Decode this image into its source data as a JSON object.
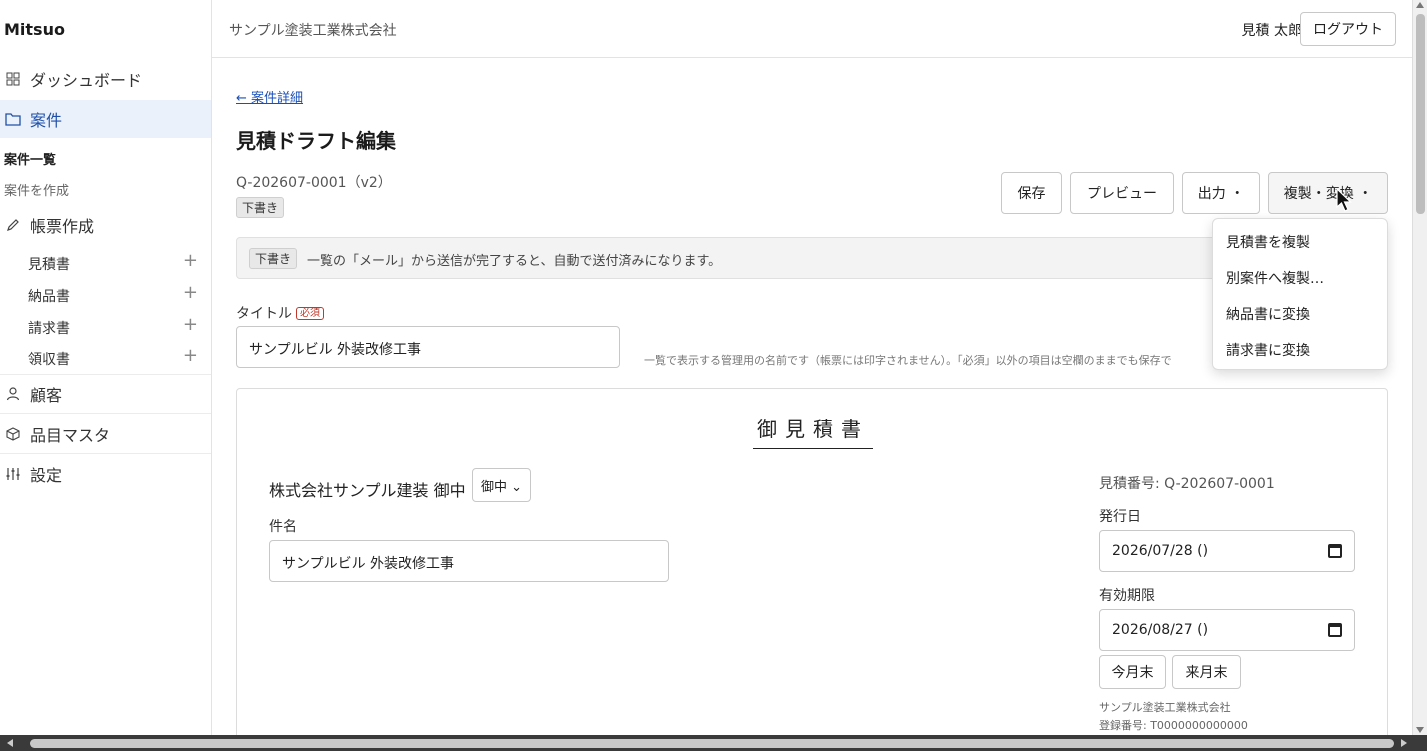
{
  "app": {
    "brand": "Mitsuo",
    "company": "サンプル塗装工業株式会社",
    "user": "見積 太郎",
    "logout": "ログアウト"
  },
  "sidebar": {
    "dashboard": "ダッシュボード",
    "cases": "案件",
    "case_list": "案件一覧",
    "case_create": "案件を作成",
    "forms": "帳票作成",
    "docs": [
      "見積書",
      "納品書",
      "請求書",
      "領収書"
    ],
    "plus": "+",
    "customers": "顧客",
    "items": "品目マスタ",
    "settings": "設定"
  },
  "main": {
    "back": "← 案件詳細",
    "title": "見積ドラフト編集",
    "doc_id": "Q-202607-0001（v2）",
    "status": "下書き",
    "buttons": {
      "save": "保存",
      "preview": "プレビュー",
      "output": "出力 ・",
      "duplicate": "複製・変換 ・"
    },
    "notice_badge": "下書き",
    "notice": "一覧の「メール」から送信が完了すると、自動で送付済みになります。",
    "title_label": "タイトル",
    "required": "必須",
    "title_value": "サンプルビル 外装改修工事",
    "hint": "一覧で表示する管理用の名前です（帳票には印字されません）。「必須」以外の項目は空欄のままでも保存で"
  },
  "paper": {
    "heading": "御見積書",
    "client": "株式会社サンプル建装 御中",
    "honorific": "御中 ⌄",
    "subject_label": "件名",
    "subject_value": "サンプルビル 外装改修工事",
    "quote_no": "見積番号: Q-202607-0001",
    "issue_label": "発行日",
    "issue_date": "2026/07/28 ()",
    "expiry_label": "有効期限",
    "expiry_date": "2026/08/27 ()",
    "this_month_end": "今月末",
    "next_month_end": "来月末",
    "issuer_name": "サンプル塗装工業株式会社",
    "issuer_reg": "登録番号: T0000000000000"
  },
  "menu": [
    "見積書を複製",
    "別案件へ複製…",
    "納品書に変換",
    "請求書に変換"
  ],
  "colors": {
    "accent": "#1f4fa8",
    "active_bg": "#eaf1fb",
    "required": "#c0392b"
  }
}
